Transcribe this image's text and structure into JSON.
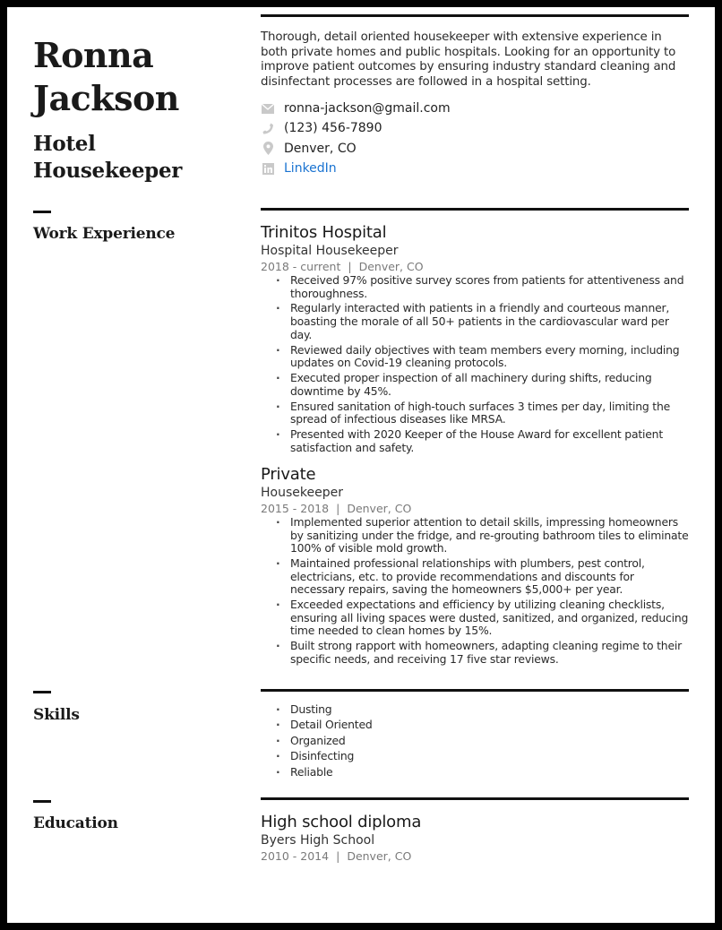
{
  "header": {
    "first_name": "Ronna",
    "last_name": "Jackson",
    "title_line1": "Hotel",
    "title_line2": "Housekeeper"
  },
  "summary": "Thorough, detail oriented housekeeper with extensive experience in both private homes and public hospitals. Looking for an opportunity to improve patient outcomes by ensuring industry standard cleaning and disinfectant processes are followed in a hospital setting.",
  "contacts": [
    {
      "icon": "envelope-icon",
      "text": "ronna-jackson@gmail.com"
    },
    {
      "icon": "phone-icon",
      "text": "(123) 456-7890"
    },
    {
      "icon": "map-pin-icon",
      "text": "Denver, CO"
    },
    {
      "icon": "linkedin-icon",
      "text": "LinkedIn",
      "color": "#1a73d1"
    }
  ],
  "sections": {
    "work": "Work Experience",
    "skills": "Skills",
    "education": "Education"
  },
  "jobs": [
    {
      "company": "Trinitos Hospital",
      "role": "Hospital Housekeeper",
      "dates": "2018 - current",
      "separator": "|",
      "location": "Denver, CO",
      "bullets": [
        "Received 97% positive survey scores from patients for attentiveness and thoroughness.",
        "Regularly interacted with patients in a friendly and courteous manner, boasting the morale of all 50+ patients in the cardiovascular ward per day.",
        "Reviewed daily objectives with team members every morning, including updates on Covid-19 cleaning protocols.",
        "Executed proper inspection of all machinery during shifts, reducing downtime by 45%.",
        "Ensured sanitation of high-touch surfaces 3 times per day, limiting the spread of infectious diseases like MRSA.",
        "Presented with 2020 Keeper of the House Award for excellent patient satisfaction and safety."
      ]
    },
    {
      "company": "Private",
      "role": "Housekeeper",
      "dates": "2015 - 2018",
      "separator": "|",
      "location": "Denver, CO",
      "bullets": [
        "Implemented superior attention to detail skills, impressing homeowners by sanitizing under the fridge, and re-grouting bathroom tiles to eliminate 100% of visible mold growth.",
        "Maintained professional relationships with plumbers, pest control, electricians, etc. to provide recommendations and discounts for necessary repairs, saving the homeowners $5,000+ per year.",
        "Exceeded expectations and efficiency by utilizing cleaning checklists, ensuring all living spaces were dusted, sanitized, and organized, reducing time needed to clean homes by 15%.",
        "Built strong rapport with homeowners, adapting cleaning regime to their specific needs, and receiving 17 five star reviews."
      ]
    }
  ],
  "skills": [
    "Dusting",
    "Detail Oriented",
    "Organized",
    "Disinfecting",
    "Reliable"
  ],
  "education": {
    "degree": "High school diploma",
    "school": "Byers High School",
    "dates": "2010 - 2014",
    "separator": "|",
    "location": "Denver, CO"
  }
}
